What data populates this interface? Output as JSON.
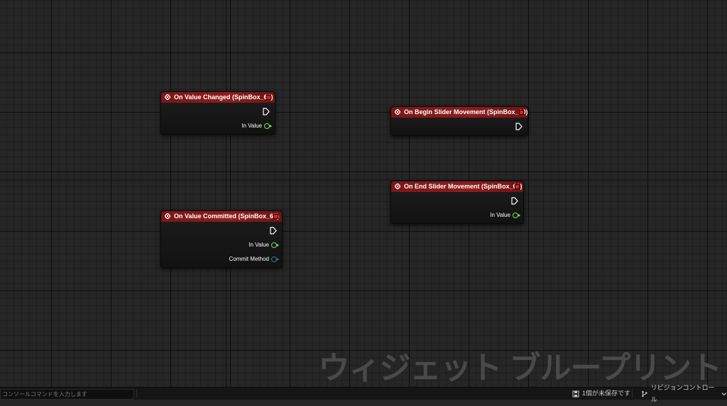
{
  "nodes": [
    {
      "title": "On Value Changed (SpinBox_60)",
      "pins": [
        "In Value"
      ]
    },
    {
      "title": "On Begin Slider Movement (SpinBox_60)",
      "pins": []
    },
    {
      "title": "On End Slider Movement (SpinBox_60)",
      "pins": [
        "In Value"
      ]
    },
    {
      "title": "On Value Committed (SpinBox_60)",
      "pins": [
        "In Value",
        "Commit Method"
      ]
    }
  ],
  "watermark": "ウィジェット ブループリント",
  "statusbar": {
    "console_placeholder": "コンソールコマンドを入力します",
    "unsaved": "1個が未保存です",
    "revision_control": "リビジョンコントロール"
  },
  "colors": {
    "node_header": "#8e1d1d",
    "float_pin": "#7be05f",
    "enum_pin": "#1b8a8a",
    "background": "#262626"
  },
  "icons": [
    "event-icon",
    "exec-pin-icon",
    "data-pin-icon",
    "save-icon",
    "branch-icon",
    "chevron-down-icon"
  ]
}
